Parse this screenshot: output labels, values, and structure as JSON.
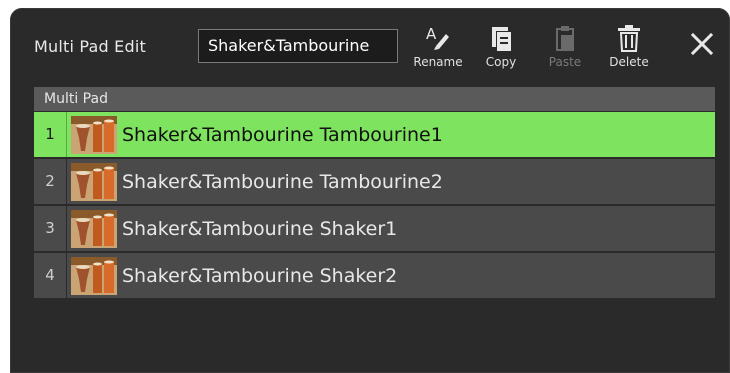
{
  "window": {
    "title": "Multi Pad Edit",
    "name_value": "Shaker&Tambourine"
  },
  "toolbar": {
    "rename_label": "Rename",
    "copy_label": "Copy",
    "paste_label": "Paste",
    "delete_label": "Delete",
    "paste_enabled": false
  },
  "list": {
    "header": "Multi Pad",
    "rows": [
      {
        "num": "1",
        "name": "Shaker&Tambourine Tambourine1",
        "selected": true
      },
      {
        "num": "2",
        "name": "Shaker&Tambourine Tambourine2",
        "selected": false
      },
      {
        "num": "3",
        "name": "Shaker&Tambourine Shaker1",
        "selected": false
      },
      {
        "num": "4",
        "name": "Shaker&Tambourine Shaker2",
        "selected": false
      }
    ]
  },
  "icons": [
    "rename-icon",
    "copy-icon",
    "paste-icon",
    "delete-icon",
    "close-icon",
    "drum-thumbnail-icon"
  ],
  "colors": {
    "panel": "#2a2a2a",
    "row": "#4a4a4a",
    "selected_row": "#7ee35e",
    "header": "#5a5a5a"
  }
}
